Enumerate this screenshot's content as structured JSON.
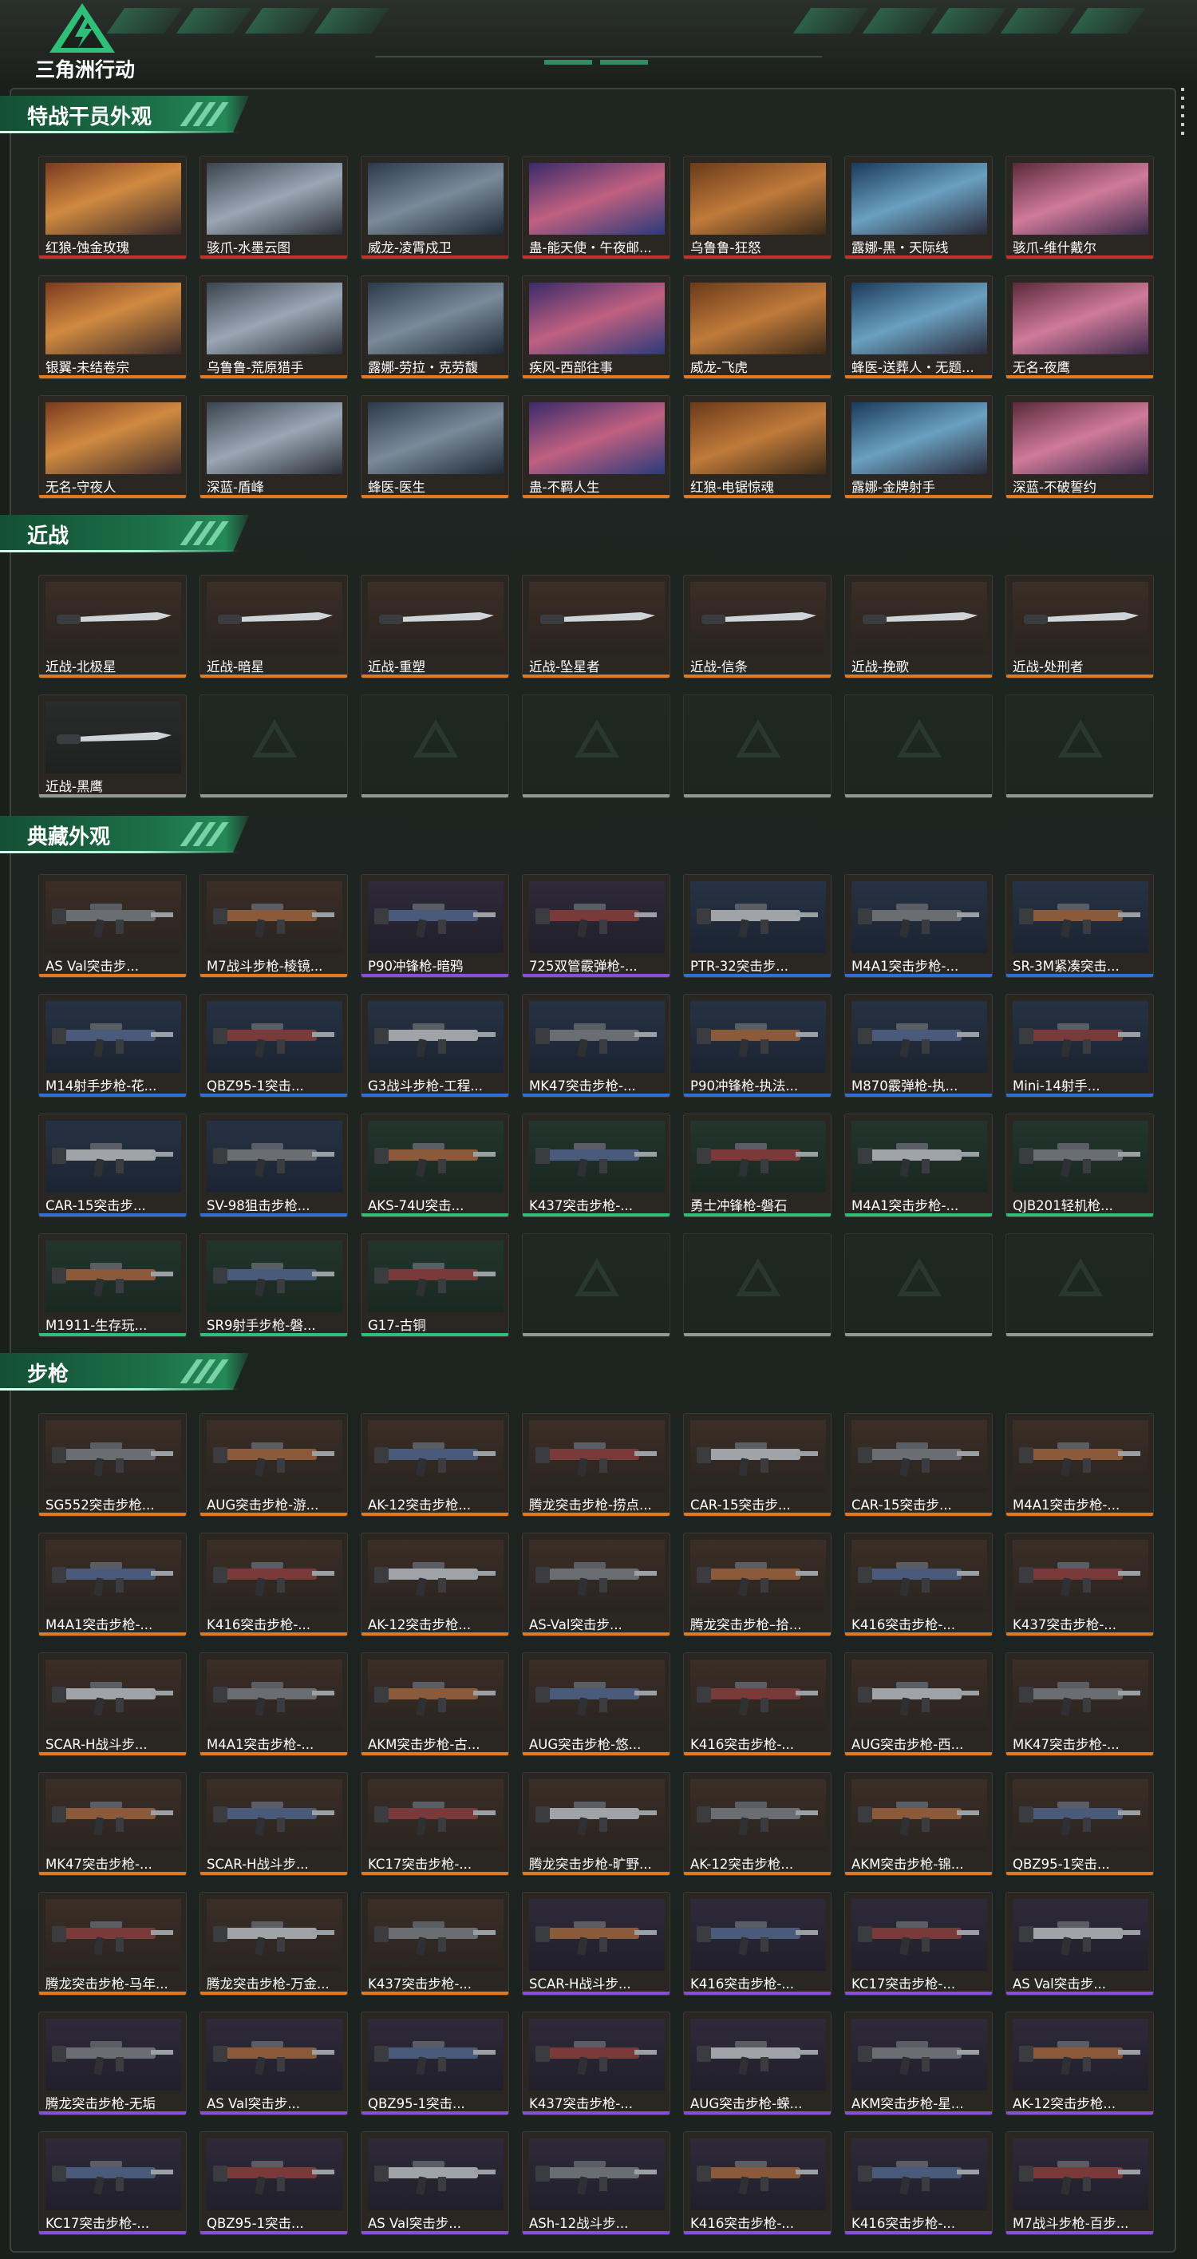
{
  "header": {
    "logo_text": "三角洲行动",
    "brand_color": "#2fa86f"
  },
  "colors": {
    "red": "#c0302c",
    "orange": "#e07a22",
    "purple": "#8a4fd8",
    "blue": "#2f6fd6",
    "green": "#2fbf78",
    "gray": "#8f9a94"
  },
  "sections": [
    {
      "title": "特战干员外观",
      "items": [
        {
          "label": "红狼-蚀金玫瑰",
          "rarity": "red"
        },
        {
          "label": "骇爪-水墨云图",
          "rarity": "red"
        },
        {
          "label": "威龙-凌霄戍卫",
          "rarity": "red"
        },
        {
          "label": "蛊-能天使・午夜邮...",
          "rarity": "red"
        },
        {
          "label": "乌鲁鲁-狂怒",
          "rarity": "red"
        },
        {
          "label": "露娜-黑・天际线",
          "rarity": "red"
        },
        {
          "label": "骇爪-维什戴尔",
          "rarity": "red"
        },
        {
          "label": "银翼-未结卷宗",
          "rarity": "orange"
        },
        {
          "label": "乌鲁鲁-荒原猎手",
          "rarity": "orange"
        },
        {
          "label": "露娜-劳拉・克劳馥",
          "rarity": "orange"
        },
        {
          "label": "疾风-西部往事",
          "rarity": "orange"
        },
        {
          "label": "威龙-飞虎",
          "rarity": "orange"
        },
        {
          "label": "蜂医-送葬人・无题...",
          "rarity": "orange"
        },
        {
          "label": "无名-夜鹰",
          "rarity": "orange"
        },
        {
          "label": "无名-守夜人",
          "rarity": "orange"
        },
        {
          "label": "深蓝-盾峰",
          "rarity": "orange"
        },
        {
          "label": "蜂医-医生",
          "rarity": "orange"
        },
        {
          "label": "蛊-不羁人生",
          "rarity": "orange"
        },
        {
          "label": "红狼-电锯惊魂",
          "rarity": "orange"
        },
        {
          "label": "露娜-金牌射手",
          "rarity": "orange"
        },
        {
          "label": "深蓝-不破誓约",
          "rarity": "orange"
        }
      ]
    },
    {
      "title": "近战",
      "items": [
        {
          "label": "近战-北极星",
          "rarity": "orange"
        },
        {
          "label": "近战-暗星",
          "rarity": "orange"
        },
        {
          "label": "近战-重塑",
          "rarity": "orange"
        },
        {
          "label": "近战-坠星者",
          "rarity": "orange"
        },
        {
          "label": "近战-信条",
          "rarity": "orange"
        },
        {
          "label": "近战-挽歌",
          "rarity": "orange"
        },
        {
          "label": "近战-处刑者",
          "rarity": "orange"
        },
        {
          "label": "近战-黑鹰",
          "rarity": "gray"
        }
      ],
      "empty_slots": 6
    },
    {
      "title": "典藏外观",
      "items": [
        {
          "label": "AS Val突击步...",
          "rarity": "orange"
        },
        {
          "label": "M7战斗步枪-棱镜...",
          "rarity": "orange"
        },
        {
          "label": "P90冲锋枪-暗鸦",
          "rarity": "purple"
        },
        {
          "label": "725双管霰弹枪-...",
          "rarity": "purple"
        },
        {
          "label": "PTR-32突击步...",
          "rarity": "blue"
        },
        {
          "label": "M4A1突击步枪-...",
          "rarity": "blue"
        },
        {
          "label": "SR-3M紧凑突击...",
          "rarity": "blue"
        },
        {
          "label": "M14射手步枪-花...",
          "rarity": "blue"
        },
        {
          "label": "QBZ95-1突击...",
          "rarity": "blue"
        },
        {
          "label": "G3战斗步枪-工程...",
          "rarity": "blue"
        },
        {
          "label": "MK47突击步枪-...",
          "rarity": "blue"
        },
        {
          "label": "P90冲锋枪-执法...",
          "rarity": "blue"
        },
        {
          "label": "M870霰弹枪-执...",
          "rarity": "blue"
        },
        {
          "label": "Mini-14射手...",
          "rarity": "blue"
        },
        {
          "label": "CAR-15突击步...",
          "rarity": "blue"
        },
        {
          "label": "SV-98狙击步枪...",
          "rarity": "blue"
        },
        {
          "label": "AKS-74U突击...",
          "rarity": "green"
        },
        {
          "label": "K437突击步枪-...",
          "rarity": "green"
        },
        {
          "label": "勇士冲锋枪-磐石",
          "rarity": "green"
        },
        {
          "label": "M4A1突击步枪-...",
          "rarity": "green"
        },
        {
          "label": "QJB201轻机枪...",
          "rarity": "green"
        },
        {
          "label": "M1911-生存玩...",
          "rarity": "green"
        },
        {
          "label": "SR9射手步枪-磐...",
          "rarity": "green"
        },
        {
          "label": "G17-古铜",
          "rarity": "green"
        }
      ],
      "empty_slots": 4
    },
    {
      "title": "步枪",
      "items": [
        {
          "label": "SG552突击步枪...",
          "rarity": "orange"
        },
        {
          "label": "AUG突击步枪-游...",
          "rarity": "orange"
        },
        {
          "label": "AK-12突击步枪...",
          "rarity": "orange"
        },
        {
          "label": "腾龙突击步枪-捞点...",
          "rarity": "orange"
        },
        {
          "label": "CAR-15突击步...",
          "rarity": "orange"
        },
        {
          "label": "CAR-15突击步...",
          "rarity": "orange"
        },
        {
          "label": "M4A1突击步枪-...",
          "rarity": "orange"
        },
        {
          "label": "M4A1突击步枪-...",
          "rarity": "orange"
        },
        {
          "label": "K416突击步枪-...",
          "rarity": "orange"
        },
        {
          "label": "AK-12突击步枪...",
          "rarity": "orange"
        },
        {
          "label": "AS-Val突击步...",
          "rarity": "orange"
        },
        {
          "label": "腾龙突击步枪–拾...",
          "rarity": "orange"
        },
        {
          "label": "K416突击步枪-...",
          "rarity": "orange"
        },
        {
          "label": "K437突击步枪-...",
          "rarity": "orange"
        },
        {
          "label": "SCAR-H战斗步...",
          "rarity": "orange"
        },
        {
          "label": "M4A1突击步枪-...",
          "rarity": "orange"
        },
        {
          "label": "AKM突击步枪-古...",
          "rarity": "orange"
        },
        {
          "label": "AUG突击步枪-悠...",
          "rarity": "orange"
        },
        {
          "label": "K416突击步枪-...",
          "rarity": "orange"
        },
        {
          "label": "AUG突击步枪-西...",
          "rarity": "orange"
        },
        {
          "label": "MK47突击步枪-...",
          "rarity": "orange"
        },
        {
          "label": "MK47突击步枪-...",
          "rarity": "orange"
        },
        {
          "label": "SCAR-H战斗步...",
          "rarity": "orange"
        },
        {
          "label": "KC17突击步枪-...",
          "rarity": "orange"
        },
        {
          "label": "腾龙突击步枪-旷野...",
          "rarity": "orange"
        },
        {
          "label": "AK-12突击步枪...",
          "rarity": "orange"
        },
        {
          "label": "AKM突击步枪-锦...",
          "rarity": "orange"
        },
        {
          "label": "QBZ95-1突击...",
          "rarity": "orange"
        },
        {
          "label": "腾龙突击步枪-马年...",
          "rarity": "orange"
        },
        {
          "label": "腾龙突击步枪-万金...",
          "rarity": "orange"
        },
        {
          "label": "K437突击步枪-...",
          "rarity": "orange"
        },
        {
          "label": "SCAR-H战斗步...",
          "rarity": "purple"
        },
        {
          "label": "K416突击步枪-...",
          "rarity": "purple"
        },
        {
          "label": "KC17突击步枪-...",
          "rarity": "purple"
        },
        {
          "label": "AS Val突击步...",
          "rarity": "purple"
        },
        {
          "label": "腾龙突击步枪-无垢",
          "rarity": "purple"
        },
        {
          "label": "AS Val突击步...",
          "rarity": "purple"
        },
        {
          "label": "QBZ95-1突击...",
          "rarity": "purple"
        },
        {
          "label": "K437突击步枪-...",
          "rarity": "purple"
        },
        {
          "label": "AUG突击步枪-蝾...",
          "rarity": "purple"
        },
        {
          "label": "AKM突击步枪-星...",
          "rarity": "purple"
        },
        {
          "label": "AK-12突击步枪...",
          "rarity": "purple"
        },
        {
          "label": "KC17突击步枪-...",
          "rarity": "purple"
        },
        {
          "label": "QBZ95-1突击...",
          "rarity": "purple"
        },
        {
          "label": "AS Val突击步...",
          "rarity": "purple"
        },
        {
          "label": "ASh-12战斗步...",
          "rarity": "purple"
        },
        {
          "label": "K416突击步枪-...",
          "rarity": "purple"
        },
        {
          "label": "K416突击步枪-...",
          "rarity": "purple"
        },
        {
          "label": "M7战斗步枪-百步...",
          "rarity": "purple"
        }
      ]
    }
  ]
}
